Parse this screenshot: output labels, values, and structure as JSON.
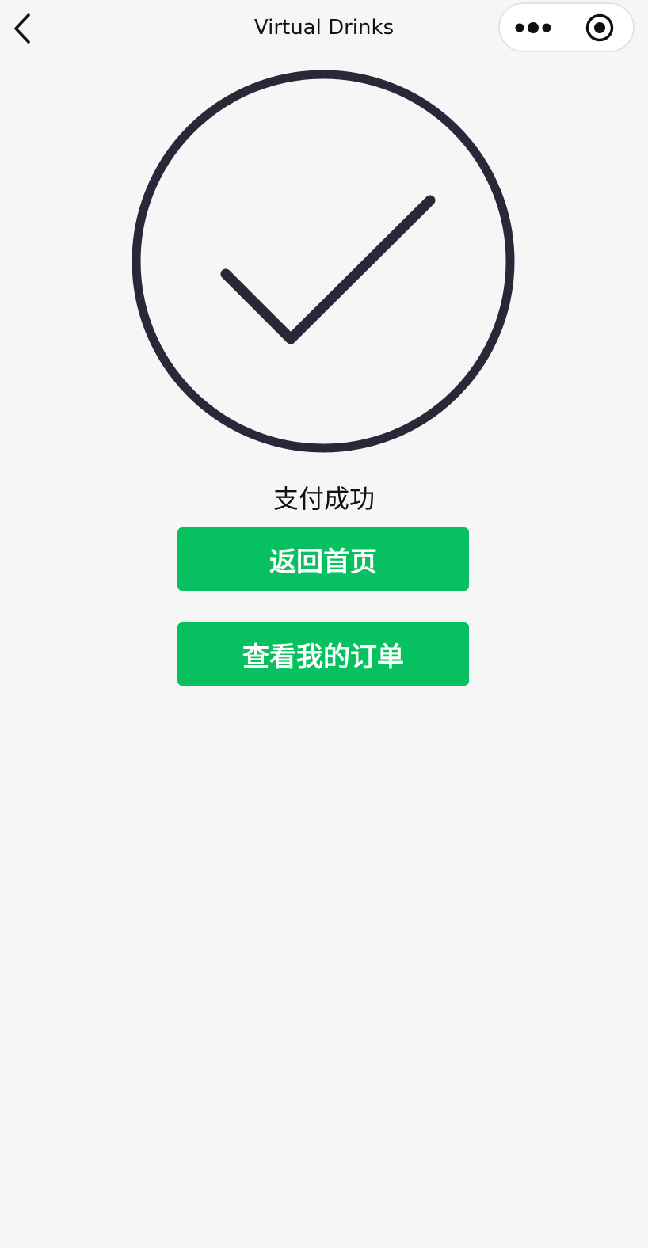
{
  "nav": {
    "title": "Virtual Drinks",
    "back_icon": "chevron-left-icon",
    "more_icon": "more-dots-icon",
    "close_icon": "target-circle-icon"
  },
  "result": {
    "icon": "check-circle-icon",
    "icon_color": "#2a2838",
    "status": "支付成功"
  },
  "actions": {
    "home_label": "返回首页",
    "orders_label": "查看我的订单",
    "button_color": "#07c160"
  }
}
